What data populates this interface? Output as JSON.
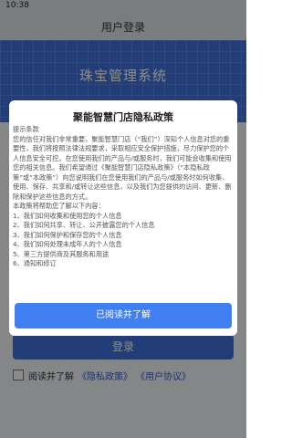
{
  "status_bar": {
    "time": "10:38"
  },
  "nav": {
    "title": "用户登录"
  },
  "hero": {
    "brand": "珠宝管理系统"
  },
  "login": {
    "button_label": "登录",
    "agree_text": "阅读并了解",
    "privacy_link": "《隐私政策》",
    "user_agreement_link": "《用户协议》"
  },
  "dialog": {
    "title": "聚能智慧门店隐私政策",
    "paragraphs": [
      "提示条款",
      "您的信任对我们非常重要，聚能智慧门店（“我们”）深知个人信息对您的重要性，我们将按照法律法规要求，采取相应安全保护措施，尽力保护您的个人信息安全可控。在您使用我们的产品与/或服务时，我们可能会收集和使用您的相关信息。我们希望通过《聚能智慧门店隐私政策》（“本隐私政策”或“本政策”）向您说明我们在您使用我们的产品与/或服务时如何收集、使用、保存、共享和/或转让这些信息，以及我们为您提供的访问、更新、删除和保护这些信息的方式。",
      "本政策将帮助您了解以下内容："
    ],
    "items": [
      "1、我们如何收集和使用您的个人信息",
      "2、我们如何共享、转让、公开披露您的个人信息",
      "3、我们如何保护和保存您的个人信息",
      "4、我们如何处理未成年人的个人信息",
      "5、第三方提供商及其服务和用途",
      "6、通知和修订"
    ],
    "confirm_label": "已阅读并了解"
  }
}
